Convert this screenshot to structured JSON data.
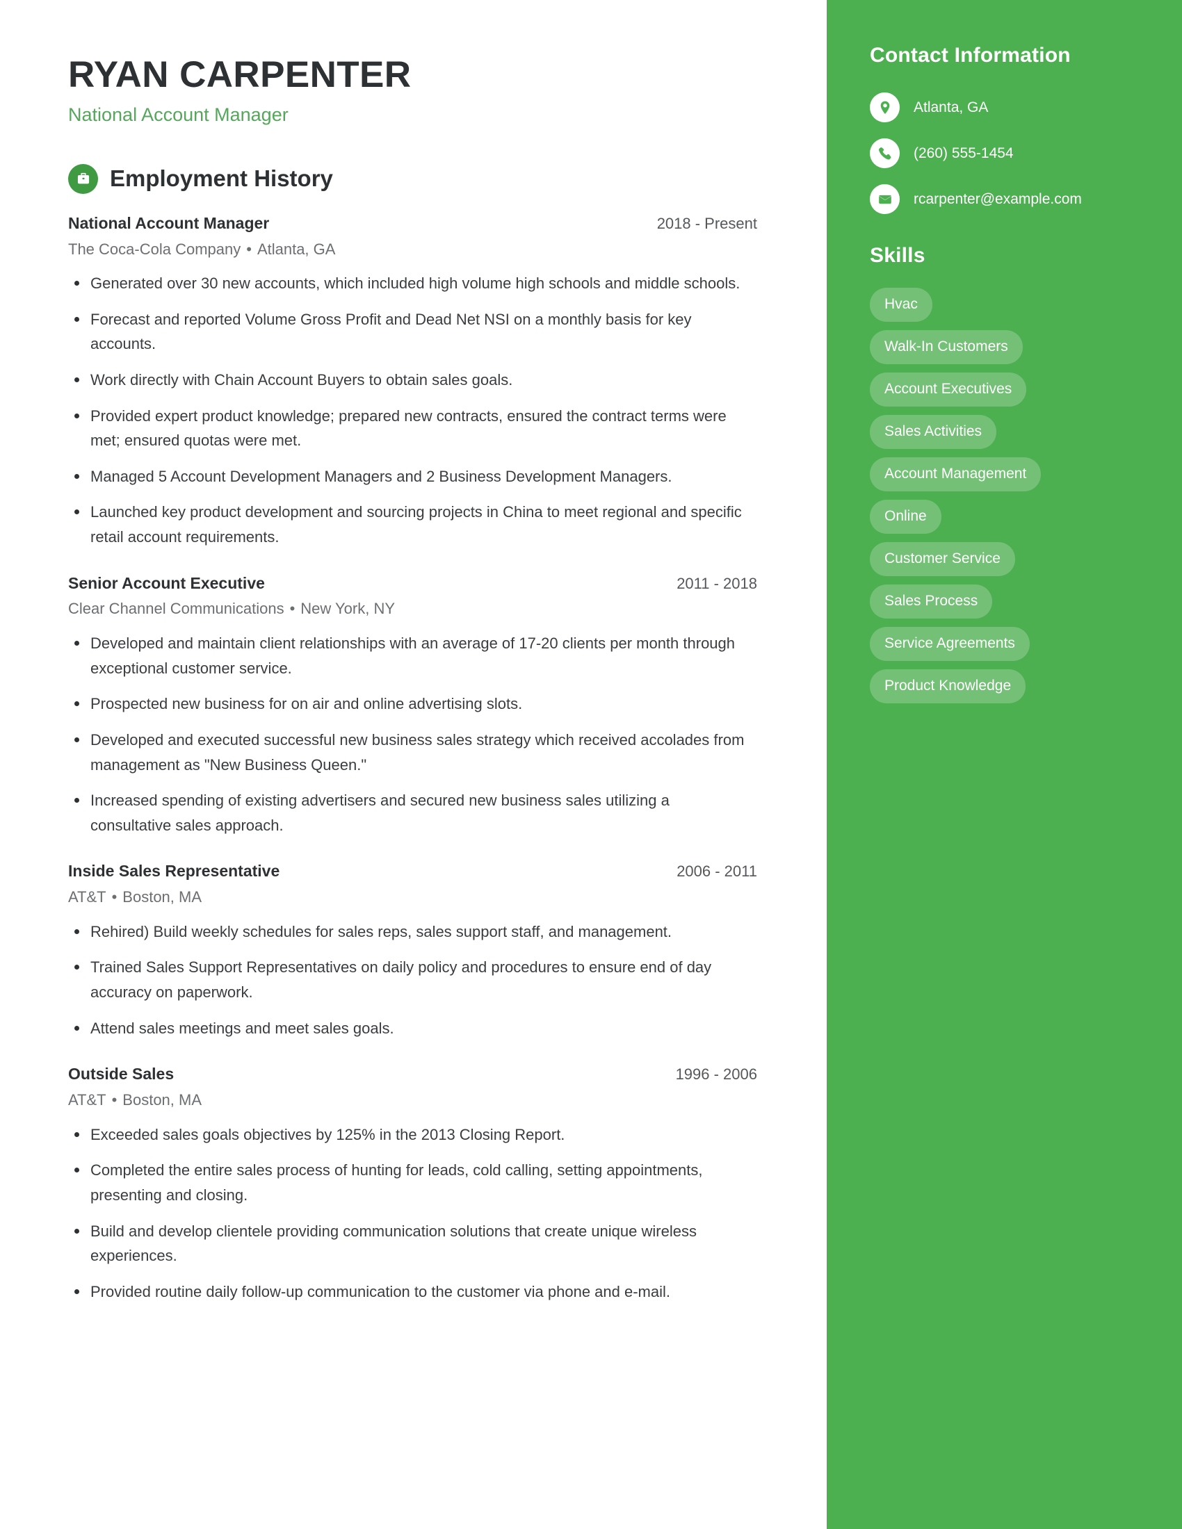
{
  "theme": {
    "accent_green": "#4CAF50",
    "icon_green": "#3f9a42",
    "subtitle_green": "#56a65c",
    "text_dark": "#2e3134"
  },
  "header": {
    "name": "RYAN CARPENTER",
    "title": "National Account Manager"
  },
  "employment": {
    "section_title": "Employment History",
    "section_icon": "briefcase-icon",
    "jobs": [
      {
        "role": "National Account Manager",
        "dates": "2018 - Present",
        "company": "The Coca-Cola Company",
        "location": "Atlanta, GA",
        "bullets": [
          "Generated over 30 new accounts, which included high volume high schools and middle schools.",
          "Forecast and reported Volume Gross Profit and Dead Net NSI on a monthly basis for key accounts.",
          "Work directly with Chain Account Buyers to obtain sales goals.",
          "Provided expert product knowledge; prepared new contracts, ensured the contract terms were met; ensured quotas were met.",
          "Managed 5 Account Development Managers and 2 Business Development Managers.",
          "Launched key product development and sourcing projects in China to meet regional and specific retail account requirements."
        ]
      },
      {
        "role": "Senior Account Executive",
        "dates": "2011 - 2018",
        "company": "Clear Channel Communications",
        "location": "New York, NY",
        "bullets": [
          "Developed and maintain client relationships with an average of 17-20 clients per month through exceptional customer service.",
          "Prospected new business for on air and online advertising slots.",
          "Developed and executed successful new business sales strategy which received accolades from management as \"New Business Queen.\"",
          "Increased spending of existing advertisers and secured new business sales utilizing a consultative sales approach."
        ]
      },
      {
        "role": "Inside Sales Representative",
        "dates": "2006 - 2011",
        "company": "AT&T",
        "location": "Boston, MA",
        "bullets": [
          "Rehired) Build weekly schedules for sales reps, sales support staff, and management.",
          "Trained Sales Support Representatives on daily policy and procedures to ensure end of day accuracy on paperwork.",
          "Attend sales meetings and meet sales goals."
        ]
      },
      {
        "role": "Outside Sales",
        "dates": "1996 - 2006",
        "company": "AT&T",
        "location": "Boston, MA",
        "bullets": [
          "Exceeded sales goals objectives by 125% in the 2013 Closing Report.",
          "Completed the entire sales process of hunting for leads, cold calling, setting appointments, presenting and closing.",
          "Build and develop clientele providing communication solutions that create unique wireless experiences.",
          "Provided routine daily follow-up communication to the customer via phone and e-mail."
        ]
      }
    ],
    "separator": "•"
  },
  "sidebar": {
    "contact_title": "Contact Information",
    "contacts": [
      {
        "icon": "location-pin-icon",
        "value": "Atlanta, GA"
      },
      {
        "icon": "phone-icon",
        "value": "(260) 555-1454"
      },
      {
        "icon": "envelope-icon",
        "value": "rcarpenter@example.com"
      }
    ],
    "skills_title": "Skills",
    "skills": [
      "Hvac",
      "Walk-In Customers",
      "Account Executives",
      "Sales Activities",
      "Account Management",
      "Online",
      "Customer Service",
      "Sales Process",
      "Service Agreements",
      "Product Knowledge"
    ]
  }
}
